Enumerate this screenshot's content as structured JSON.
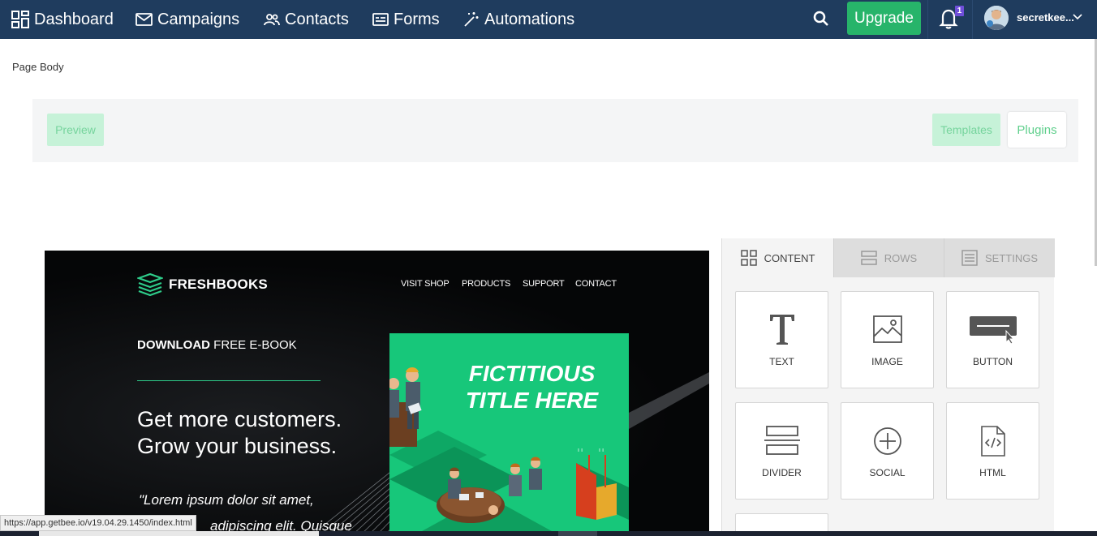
{
  "nav": {
    "dashboard": "Dashboard",
    "campaigns": "Campaigns",
    "contacts": "Contacts",
    "forms": "Forms",
    "automations": "Automations",
    "upgrade": "Upgrade",
    "notification_count": "1",
    "username": "secretkee..."
  },
  "page": {
    "section_label": "Page Body",
    "preview": "Preview",
    "templates": "Templates",
    "plugins": "Plugins"
  },
  "email": {
    "brand": "FRESHBOOKS",
    "menu": [
      "VISIT SHOP",
      "PRODUCTS",
      "SUPPORT",
      "CONTACT"
    ],
    "download_bold": "DOWNLOAD",
    "download_rest": " FREE E-BOOK",
    "headline_1": "Get more customers.",
    "headline_2": "Grow your business.",
    "quote_1": "\"Lorem ipsum dolor sit amet,",
    "quote_2": "adipiscing elit. Quisque",
    "book_title_1": "FICTITIOUS",
    "book_title_2": "TITLE HERE"
  },
  "panel": {
    "tabs": [
      "CONTENT",
      "ROWS",
      "SETTINGS"
    ],
    "tiles": [
      "TEXT",
      "IMAGE",
      "BUTTON",
      "DIVIDER",
      "SOCIAL",
      "HTML"
    ]
  },
  "status": {
    "url": "https://app.getbee.io/v19.04.29.1450/index.html"
  },
  "colors": {
    "nav_bg": "#1f3c5e",
    "upgrade_green": "#27b46a",
    "book_green": "#17c77a",
    "badge_purple": "#6f4fd9"
  }
}
